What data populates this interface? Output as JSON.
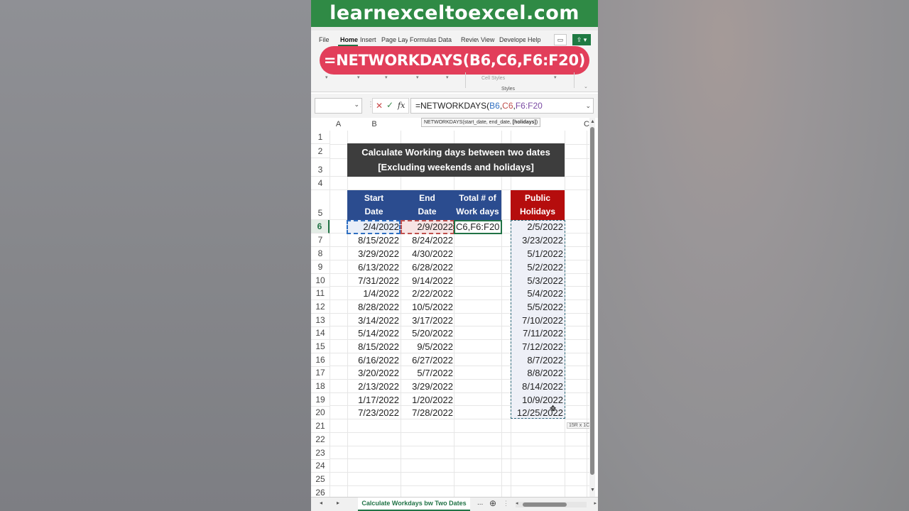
{
  "banner": {
    "site": "learnexceltoexcel.com"
  },
  "ribbon": {
    "tabs": [
      "File",
      "Home",
      "Insert",
      "Page Lay",
      "Formulas",
      "Data",
      "Review",
      "View",
      "Develope",
      "Help"
    ],
    "active_tab": "Home",
    "formula_overlay": "=NETWORKDAYS(B6,C6,F6:F20)",
    "cell_styles_label": "Cell Styles",
    "styles_group_label": "Styles"
  },
  "formula_bar": {
    "name_box_value": "",
    "fx_label": "fx",
    "formula_parts": [
      "=NETWORKDAYS(",
      "B6",
      ",",
      "C6",
      ",",
      "F6:F20"
    ],
    "tooltip_prefix": "NETWORKDAYS(start_date, end_date, ",
    "tooltip_bold": "[holidays]",
    "tooltip_suffix": ")"
  },
  "sheet": {
    "columns": [
      "A",
      "B",
      "C"
    ],
    "rows": [
      "1",
      "2",
      "3",
      "4",
      "5",
      "6",
      "7",
      "8",
      "9",
      "10",
      "11",
      "12",
      "13",
      "14",
      "15",
      "16",
      "17",
      "18",
      "19",
      "20",
      "21",
      "22",
      "23",
      "24",
      "25",
      "26"
    ],
    "selected_row": "6",
    "title_line1": "Calculate Working days between two dates",
    "title_line2": "[Excluding weekends and holidays]",
    "headers": {
      "start_line1": "Start",
      "start_line2": "Date",
      "end_line1": "End",
      "end_line2": "Date",
      "total_line1": "Total # of",
      "total_line2": "Work days",
      "holidays_line1": "Public",
      "holidays_line2": "Holidays"
    },
    "start_dates": [
      "2/4/2022",
      "8/15/2022",
      "3/29/2022",
      "6/13/2022",
      "7/31/2022",
      "1/4/2022",
      "8/28/2022",
      "3/14/2022",
      "5/14/2022",
      "8/15/2022",
      "6/16/2022",
      "3/20/2022",
      "2/13/2022",
      "1/17/2022",
      "7/23/2022"
    ],
    "end_dates": [
      "2/9/2022",
      "8/24/2022",
      "4/30/2022",
      "6/28/2022",
      "9/14/2022",
      "2/22/2022",
      "10/5/2022",
      "3/17/2022",
      "5/20/2022",
      "9/5/2022",
      "6/27/2022",
      "5/7/2022",
      "3/29/2022",
      "1/20/2022",
      "7/28/2022"
    ],
    "editing_cell_text": "C6,F6:F20",
    "holidays": [
      "2/5/2022",
      "3/23/2022",
      "5/1/2022",
      "5/2/2022",
      "5/3/2022",
      "5/4/2022",
      "5/5/2022",
      "7/10/2022",
      "7/11/2022",
      "7/12/2022",
      "8/7/2022",
      "8/8/2022",
      "8/14/2022",
      "10/9/2022",
      "12/25/2022"
    ],
    "range_size_tip": "15R x 1C"
  },
  "sheet_bar": {
    "active_sheet": "Calculate Workdays bw Two Dates",
    "more": "...",
    "add": "⊕"
  },
  "colors": {
    "banner_green": "#2f8a45",
    "overlay_pink": "#e23e5a",
    "header_blue": "#2b4c8f",
    "header_red": "#b50d0d",
    "title_dark": "#3d3d3d",
    "excel_green": "#217346"
  },
  "icons": [
    "cancel-icon",
    "enter-check-icon",
    "function-icon",
    "dropdown-caret-icon",
    "share-icon",
    "comment-icon",
    "move-cursor-icon"
  ]
}
